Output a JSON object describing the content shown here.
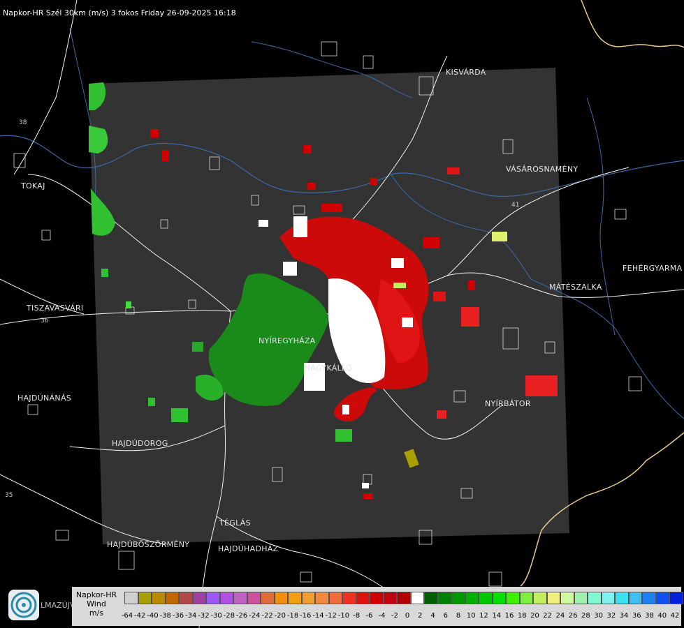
{
  "title": "Napkor-HR Szél 30km (m/s) 3 fokos Friday 26-09-2025 16:18",
  "towns": [
    {
      "id": "kisvarda",
      "name": "KISVÁRDA"
    },
    {
      "id": "vasarosnameny",
      "name": "VÁSÁROSNAMÉNY"
    },
    {
      "id": "tokaj",
      "name": "TOKAJ"
    },
    {
      "id": "fehergyarmat",
      "name": "FEHÉRGYARMA"
    },
    {
      "id": "mateszalka",
      "name": "MÁTÉSZALKA"
    },
    {
      "id": "tiszavasvari",
      "name": "TISZAVASVÁRI"
    },
    {
      "id": "nyiregyhaza",
      "name": "NYÍREGYHÁZA"
    },
    {
      "id": "nagykallo",
      "name": "NAGYKÁLLÓ"
    },
    {
      "id": "hajdunanas",
      "name": "HAJDÚNÁNÁS"
    },
    {
      "id": "nyirbator",
      "name": "NYÍRBÁTOR"
    },
    {
      "id": "hajdudorog",
      "name": "HAJDÚDOROG"
    },
    {
      "id": "teglas",
      "name": "TÉGLÁS"
    },
    {
      "id": "hajduboszormeny",
      "name": "HAJDÚBÖSZÖRMÉNY"
    },
    {
      "id": "hajduhadhaz",
      "name": "HAJDÚHADHÁZ"
    },
    {
      "id": "balmazujvaros",
      "name": "LMAZÚJVÁR"
    }
  ],
  "road_numbers": [
    "38",
    "41",
    "36",
    "35"
  ],
  "legend": {
    "name": "Napkor-HR",
    "quantity": "Wind",
    "unit": "m/s",
    "colors": [
      "#d0d0d0",
      "#a8a000",
      "#b88a00",
      "#c06800",
      "#b04a4a",
      "#a040a0",
      "#9a58f0",
      "#b050e0",
      "#c060c0",
      "#d050a0",
      "#e06c3c",
      "#f09010",
      "#f0a010",
      "#f0a030",
      "#f08a40",
      "#f06a40",
      "#f03020",
      "#e01010",
      "#d00000",
      "#c00010",
      "#b00000",
      "#ffffff",
      "#006000",
      "#008000",
      "#009a00",
      "#00b000",
      "#00c800",
      "#00e000",
      "#40f000",
      "#80f040",
      "#c0f060",
      "#f0f080",
      "#d0f8a0",
      "#a0f0b0",
      "#80f8d0",
      "#80f0f0",
      "#40e0f0",
      "#40c0f0",
      "#2080f0",
      "#1050f0",
      "#0020e0"
    ],
    "ticks": [
      "-64",
      "-42",
      "-40",
      "-38",
      "-36",
      "-34",
      "-32",
      "-30",
      "-28",
      "-26",
      "-24",
      "-22",
      "-20",
      "-18",
      "-16",
      "-14",
      "-12",
      "-10",
      "-8",
      "-6",
      "-4",
      "-2",
      "0",
      "2",
      "4",
      "6",
      "8",
      "10",
      "12",
      "14",
      "16",
      "18",
      "20",
      "22",
      "24",
      "26",
      "28",
      "30",
      "32",
      "34",
      "36",
      "38",
      "40",
      "42"
    ]
  }
}
